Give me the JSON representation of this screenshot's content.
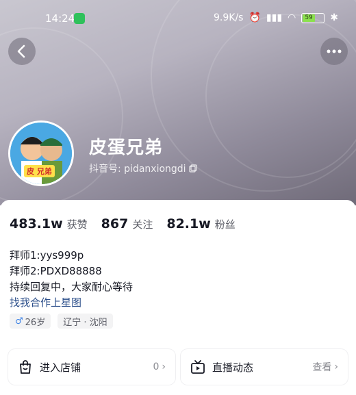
{
  "status_bar": {
    "time": "14:24",
    "network_speed": "9.9K/s",
    "battery_level": "59"
  },
  "profile": {
    "nickname": "皮蛋兄弟",
    "id_label": "抖音号: pidanxiongdi",
    "avatar_text": "皮 兄弟"
  },
  "stats": [
    {
      "value": "483.1w",
      "label": "获赞"
    },
    {
      "value": "867",
      "label": "关注"
    },
    {
      "value": "82.1w",
      "label": "粉丝"
    }
  ],
  "bio": {
    "lines": [
      "拜师1:yys999p",
      "拜师2:PDXD88888",
      "持续回复中，大家耐心等待"
    ],
    "link": "找我合作上星图"
  },
  "tags": {
    "age": "26岁",
    "location": "辽宁 · 沈阳"
  },
  "cards": {
    "shop": {
      "label": "进入店铺",
      "count": "0"
    },
    "live": {
      "label": "直播动态",
      "action": "查看"
    }
  },
  "colors": {
    "link": "#2b4e8a",
    "male": "#3c82e6",
    "text": "#161823",
    "secondary": "#5b5d66"
  }
}
